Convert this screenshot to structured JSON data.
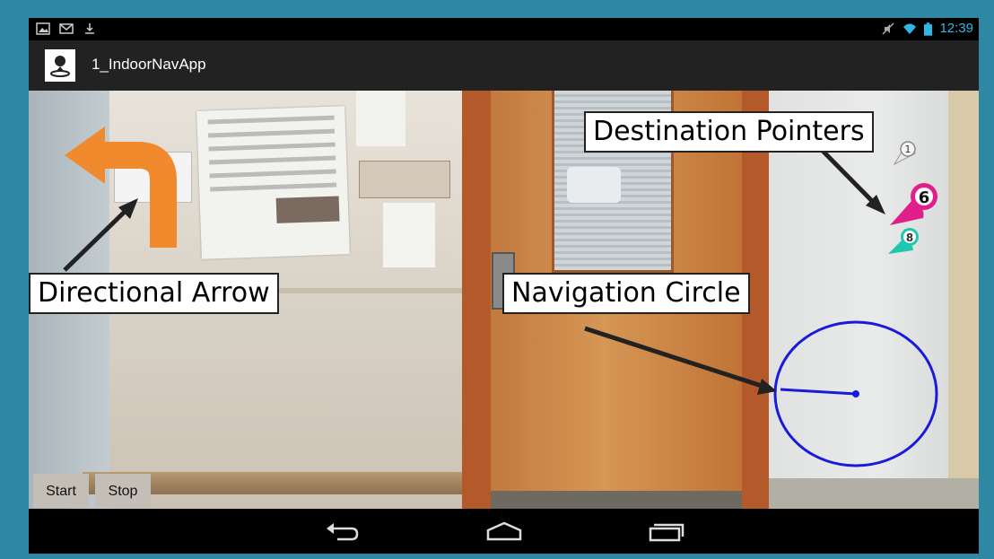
{
  "status_bar": {
    "left_icons": [
      "picture-icon",
      "mail-icon",
      "download-icon"
    ],
    "right_icons": [
      "mute-icon",
      "wifi-icon",
      "battery-icon"
    ],
    "clock": "12:39",
    "clock_color": "#33b5e5"
  },
  "action_bar": {
    "app_icon": "map-pin-person-icon",
    "title": "1_IndoorNavApp"
  },
  "camera_view": {
    "directional_arrow_icon": "u-turn-left-arrow-icon",
    "arrow_color": "#f08a2c",
    "destination_pointers": [
      {
        "label": "1",
        "color": "#e8e8e8"
      },
      {
        "label": "6",
        "color": "#e01f8a"
      },
      {
        "label": "8",
        "color": "#1fc7b0"
      }
    ],
    "navigation_circle_color": "#1a1adb"
  },
  "callouts": {
    "destination_pointers": "Destination Pointers",
    "directional_arrow": "Directional Arrow",
    "navigation_circle": "Navigation Circle"
  },
  "controls": {
    "start_label": "Start",
    "stop_label": "Stop"
  },
  "nav_bar": {
    "back_icon": "back-icon",
    "home_icon": "home-icon",
    "recents_icon": "recents-icon"
  },
  "colors": {
    "frame": "#2e87a3",
    "action_bar": "#222222"
  }
}
